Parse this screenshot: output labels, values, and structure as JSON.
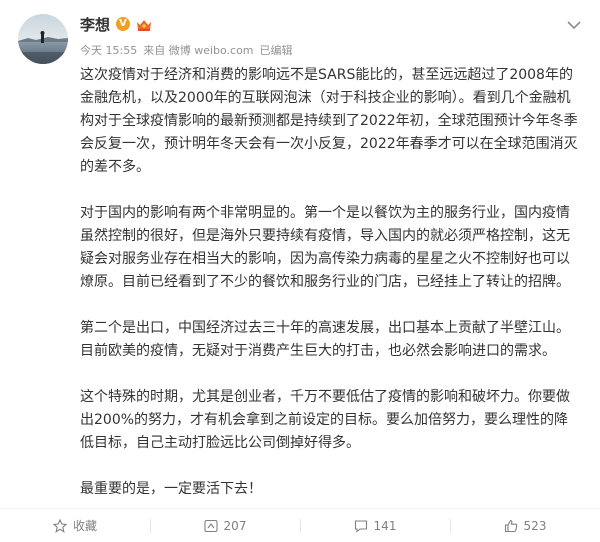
{
  "author": {
    "name": "李想",
    "vip_badge": "V",
    "crown_color": "#f06a2a"
  },
  "meta": {
    "time": "今天 15:55",
    "source": "来自 微博 weibo.com",
    "edited": "已编辑"
  },
  "content": {
    "paragraphs": [
      "这次疫情对于经济和消费的影响远不是SARS能比的，甚至远远超过了2008年的金融危机，以及2000年的互联网泡沫（对于科技企业的影响）。看到几个金融机构对于全球疫情影响的最新预测都是持续到了2022年初，全球范围预计今年冬季会反复一次，预计明年冬天会有一次小反复，2022年春季才可以在全球范围消灭的差不多。",
      "对于国内的影响有两个非常明显的。第一个是以餐饮为主的服务行业，国内疫情虽然控制的很好，但是海外只要持续有疫情，导入国内的就必须严格控制，这无疑会对服务业存在相当大的影响，因为高传染力病毒的星星之火不控制好也可以燎原。目前已经看到了不少的餐饮和服务行业的门店，已经挂上了转让的招牌。",
      "第二个是出口，中国经济过去三十年的高速发展，出口基本上贡献了半壁江山。目前欧美的疫情，无疑对于消费产生巨大的打击，也必然会影响进口的需求。",
      "这个特殊的时期，尤其是创业者，千万不要低估了疫情的影响和破坏力。你要做出200%的努力，才有机会拿到之前设定的目标。要么加倍努力，要么理性的降低目标，自己主动打脸远比公司倒掉好得多。",
      "最重要的是，一定要活下去！"
    ]
  },
  "actions": {
    "favorite": "收藏",
    "repost": "207",
    "comment": "141",
    "like": "523"
  },
  "colors": {
    "text": "#333333",
    "meta": "#939393",
    "action": "#808080",
    "vip": "#f0a020"
  }
}
